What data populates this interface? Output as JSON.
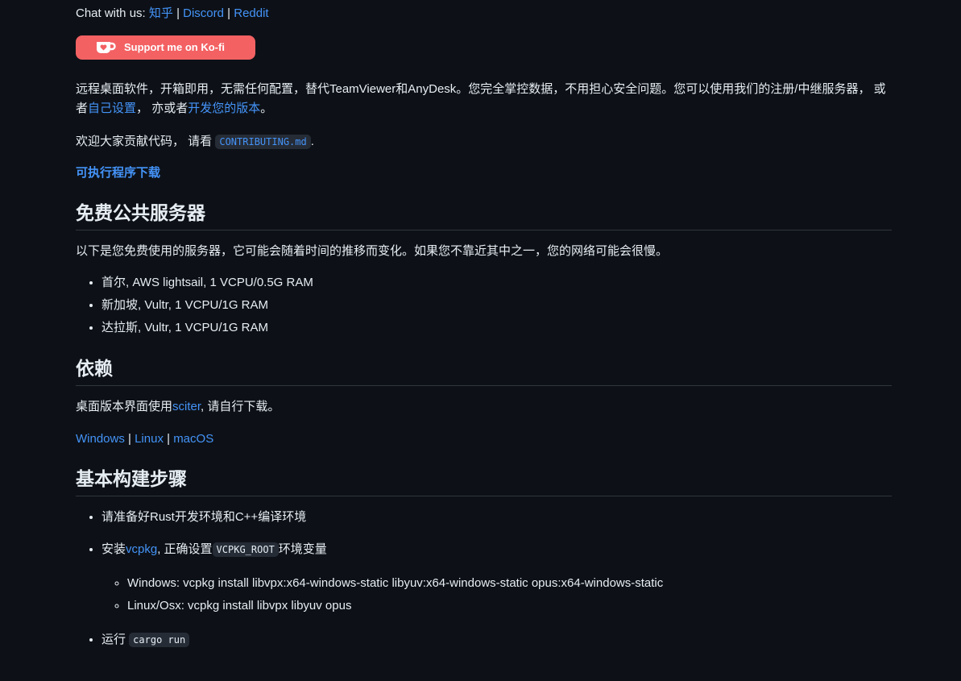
{
  "chat": {
    "prefix": "Chat with us:",
    "zhihu": "知乎",
    "sep": " | ",
    "discord": "Discord",
    "reddit": "Reddit"
  },
  "kofi": {
    "label": "Support me on Ko-fi"
  },
  "intro": {
    "text1": "远程桌面软件，开箱即用，无需任何配置，替代TeamViewer和AnyDesk。您完全掌控数据，不用担心安全问题。您可以使用我们的注册/中继服务器，  或者",
    "link1": "自己设置",
    "text2": "，  亦或者",
    "link2": "开发您的版本",
    "text3": "。"
  },
  "contrib": {
    "text": "欢迎大家贡献代码，  请看 ",
    "code": "CONTRIBUTING.md",
    "end": "."
  },
  "download": {
    "label": "可执行程序下载"
  },
  "servers": {
    "heading": "免费公共服务器",
    "desc": "以下是您免费使用的服务器，它可能会随着时间的推移而变化。如果您不靠近其中之一，您的网络可能会很慢。",
    "items": [
      "首尔, AWS lightsail, 1 VCPU/0.5G RAM",
      "新加坡, Vultr, 1 VCPU/1G RAM",
      "达拉斯, Vultr, 1 VCPU/1G RAM"
    ]
  },
  "deps": {
    "heading": "依赖",
    "text1": "桌面版本界面使用",
    "link": "sciter",
    "text2": ", 请自行下载。",
    "windows": "Windows",
    "linux": "Linux",
    "macos": "macOS",
    "sep": " | "
  },
  "build": {
    "heading": "基本构建步骤",
    "step1": "请准备好Rust开发环境和C++编译环境",
    "step2_pre": "安装",
    "step2_link": "vcpkg",
    "step2_mid": ", 正确设置",
    "step2_code": "VCPKG_ROOT",
    "step2_post": "环境变量",
    "sub": [
      "Windows: vcpkg install libvpx:x64-windows-static libyuv:x64-windows-static opus:x64-windows-static",
      "Linux/Osx: vcpkg install libvpx libyuv opus"
    ],
    "step3_pre": "运行 ",
    "step3_code": "cargo run"
  }
}
